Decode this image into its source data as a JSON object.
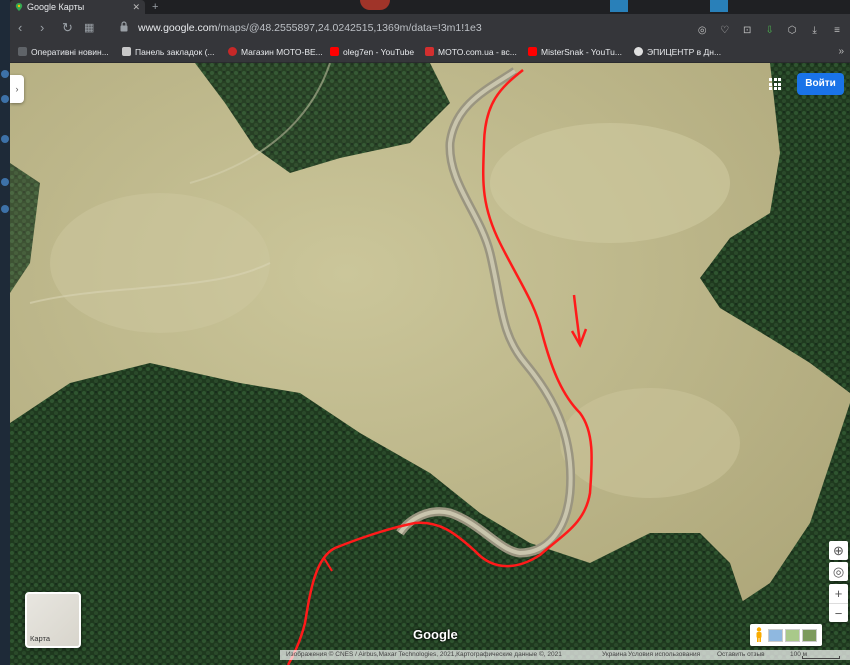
{
  "browser": {
    "tab_title": "Google Карты",
    "new_tab": "+",
    "url_domain": "www.google.com",
    "url_path": "/maps/@48.2555897,24.0242515,1369m/data=!3m1!1e3",
    "bookmarks": [
      {
        "label": "Оперативні новин...",
        "icon": "ukr-net-icon",
        "color": "#5f6368"
      },
      {
        "label": "Панель закладок (...",
        "icon": "folder-icon",
        "color": "#c8c8c8"
      },
      {
        "label": "Магазин MOTO-BE...",
        "icon": "moto-icon",
        "color": "#c62828"
      },
      {
        "label": "oleg7en - YouTube",
        "icon": "youtube-icon",
        "color": "#ff0000"
      },
      {
        "label": "MOTO.com.ua - вс...",
        "icon": "moto-icon",
        "color": "#d32f2f"
      },
      {
        "label": "MisterSnak - YouTu...",
        "icon": "youtube-icon",
        "color": "#ff0000"
      },
      {
        "label": "ЭПИЦЕНТР в Дн...",
        "icon": "epicenter-icon",
        "color": "#e0e0e0"
      }
    ],
    "more_bookmarks": "»"
  },
  "map": {
    "sign_in_label": "Войти",
    "layer_label": "Карта",
    "google_logo": "Google",
    "footer": {
      "imagery": "Изображения © CNES / Airbus,Maxar Technologies, 2021,Картографические данные ©, 2021",
      "country": "Украина",
      "terms": "Условия использования",
      "feedback": "Оставить отзыв",
      "scale": "100 м"
    },
    "accent_color": "#1a73e8",
    "route_color": "#ff1a1a"
  }
}
